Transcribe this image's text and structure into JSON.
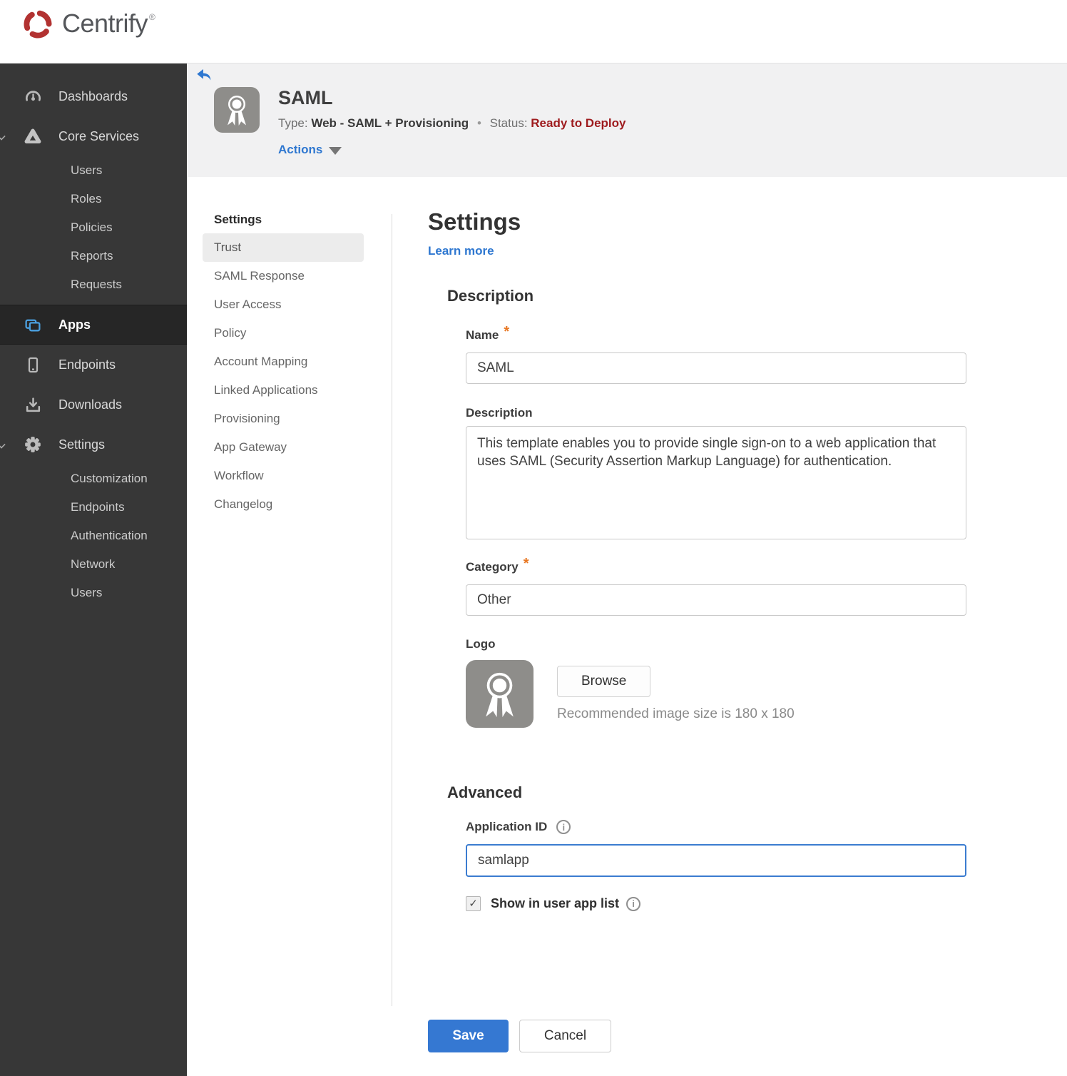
{
  "brand": {
    "name": "Centrify",
    "registered": "®"
  },
  "ui": {
    "required_marker": "*",
    "checkmark": "✓",
    "info_glyph": "i"
  },
  "icons": {
    "brand": "centrify-swirl-icon",
    "back": "back-arrow-icon",
    "app_logo": "award-ribbon-icon",
    "caret": "caret-down-icon",
    "dashboards": "gauge-icon",
    "core_services": "triangle-knot-icon",
    "apps": "stacked-windows-icon",
    "endpoints": "mobile-device-icon",
    "downloads": "download-tray-icon",
    "settings": "gear-icon",
    "expander": "chevron-down-icon",
    "info": "info-circle-icon"
  },
  "sidebar": {
    "items": [
      {
        "label": "Dashboards",
        "icon": "gauge-icon"
      },
      {
        "label": "Core Services",
        "icon": "triangle-knot-icon",
        "expanded": true,
        "children": [
          "Users",
          "Roles",
          "Policies",
          "Reports",
          "Requests"
        ]
      },
      {
        "label": "Apps",
        "icon": "stacked-windows-icon",
        "active": true
      },
      {
        "label": "Endpoints",
        "icon": "mobile-device-icon"
      },
      {
        "label": "Downloads",
        "icon": "download-tray-icon"
      },
      {
        "label": "Settings",
        "icon": "gear-icon",
        "expanded": true,
        "children": [
          "Customization",
          "Endpoints",
          "Authentication",
          "Network",
          "Users"
        ]
      }
    ]
  },
  "app_header": {
    "title": "SAML",
    "type_label": "Type:",
    "type_value": "Web - SAML + Provisioning",
    "separator": "•",
    "status_label": "Status:",
    "status_value": "Ready to Deploy",
    "actions_label": "Actions"
  },
  "subnav": {
    "header": "Settings",
    "active": "Trust",
    "items": [
      "Trust",
      "SAML Response",
      "User Access",
      "Policy",
      "Account Mapping",
      "Linked Applications",
      "Provisioning",
      "App Gateway",
      "Workflow",
      "Changelog"
    ]
  },
  "main": {
    "title": "Settings",
    "learn_more": "Learn more",
    "description_section": {
      "heading": "Description",
      "name_label": "Name",
      "name_value": "SAML",
      "description_label": "Description",
      "description_value": "This template enables you to provide single sign-on to a web application that uses SAML (Security Assertion Markup Language) for authentication.",
      "category_label": "Category",
      "category_value": "Other",
      "logo_label": "Logo",
      "browse_label": "Browse",
      "logo_hint": "Recommended image size is 180 x 180"
    },
    "advanced_section": {
      "heading": "Advanced",
      "app_id_label": "Application ID",
      "app_id_value": "samlapp",
      "show_in_list_label": "Show in user app list",
      "show_in_list_checked": true
    },
    "footer": {
      "save_label": "Save",
      "cancel_label": "Cancel"
    }
  },
  "colors": {
    "accent_blue": "#2e77d0",
    "save_blue": "#3578d2",
    "status_red": "#9e1b1e",
    "required_orange": "#e87722",
    "sidebar_bg": "#373737",
    "sidebar_active_bg": "#262626",
    "apps_icon_blue": "#4ba0e0",
    "header_band": "#f1f1f2",
    "brand_red": "#b23231"
  }
}
